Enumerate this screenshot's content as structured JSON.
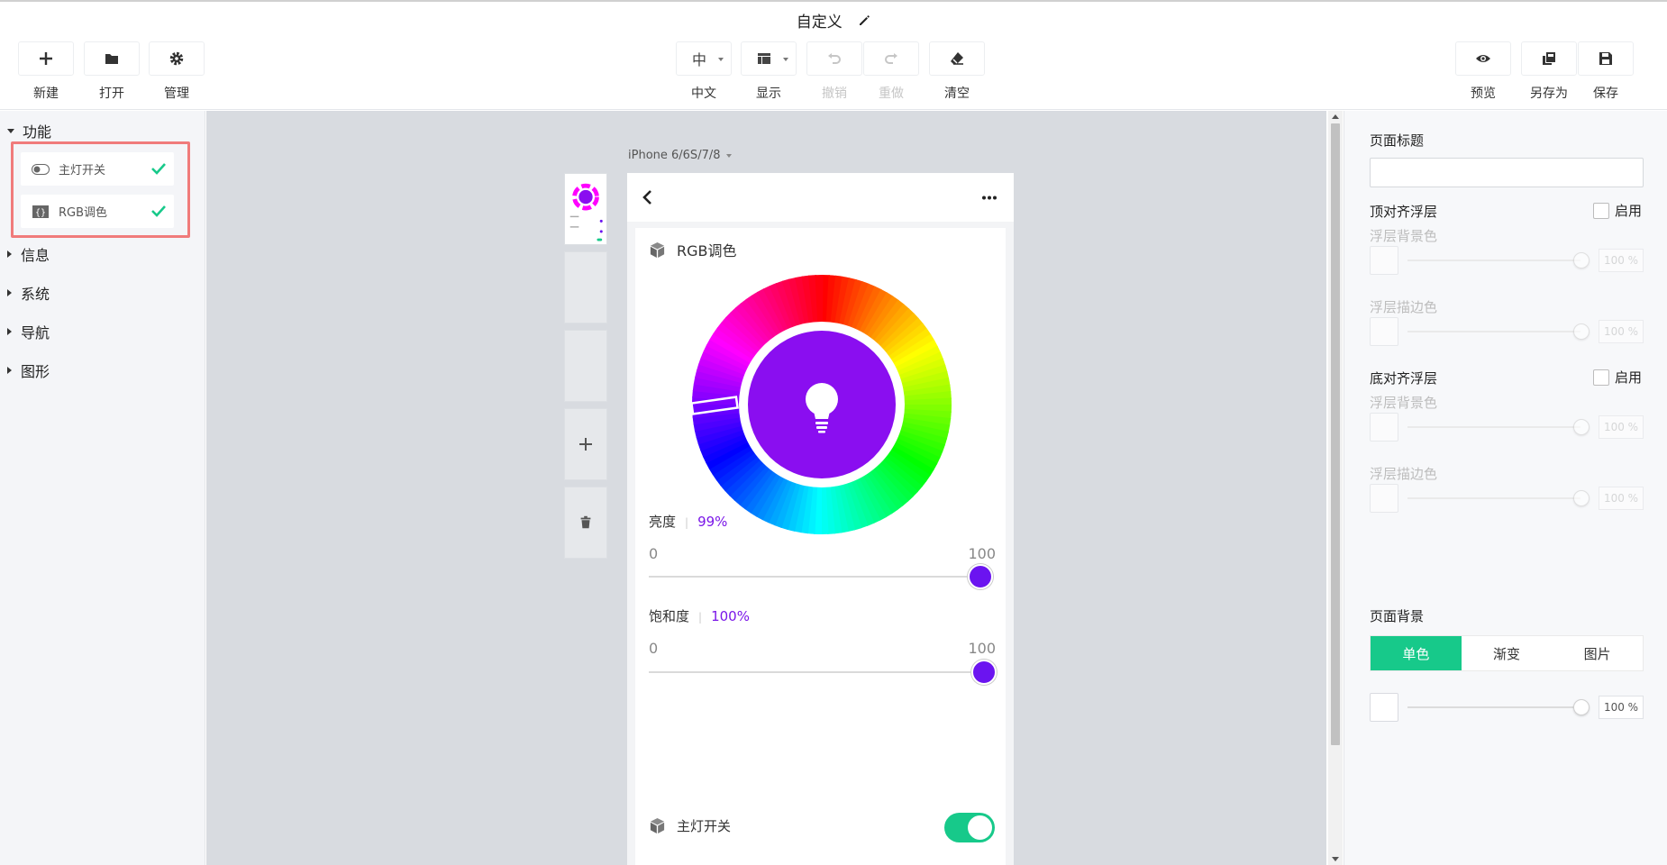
{
  "document": {
    "title": "自定义"
  },
  "toolbar": {
    "new_label": "新建",
    "open_label": "打开",
    "manage_label": "管理",
    "lang_value": "中",
    "lang_label": "中文",
    "display_label": "显示",
    "undo_label": "撤销",
    "redo_label": "重做",
    "clear_label": "清空",
    "preview_label": "预览",
    "save_as_label": "另存为",
    "save_label": "保存"
  },
  "sidebar": {
    "categories": [
      {
        "label": "功能",
        "expanded": true
      },
      {
        "label": "信息",
        "expanded": false
      },
      {
        "label": "系统",
        "expanded": false
      },
      {
        "label": "导航",
        "expanded": false
      },
      {
        "label": "图形",
        "expanded": false
      }
    ],
    "components": [
      {
        "label": "主灯开关",
        "icon": "toggle-icon",
        "added": true
      },
      {
        "label": "RGB调色",
        "icon": "braces-icon",
        "added": true
      }
    ]
  },
  "canvas": {
    "device": "iPhone 6/6S/7/8"
  },
  "phone": {
    "rgb_title": "RGB调色",
    "brightness_label": "亮度",
    "brightness_value": "99%",
    "brightness_min": "0",
    "brightness_max": "100",
    "brightness_fraction": 0.99,
    "saturation_label": "饱和度",
    "saturation_value": "100%",
    "saturation_min": "0",
    "saturation_max": "100",
    "saturation_fraction": 1.0,
    "switch_label": "主灯开关",
    "switch_on": true,
    "selected_color": "#8a0ef0"
  },
  "props": {
    "page_title_label": "页面标题",
    "page_title_value": "",
    "top_layer_label": "顶对齐浮层",
    "top_enable_label": "启用",
    "top_bg_label": "浮层背景色",
    "top_bg_pct": "100 %",
    "top_border_label": "浮层描边色",
    "top_border_pct": "100 %",
    "bottom_layer_label": "底对齐浮层",
    "bottom_enable_label": "启用",
    "bottom_bg_label": "浮层背景色",
    "bottom_bg_pct": "100 %",
    "bottom_border_label": "浮层描边色",
    "bottom_border_pct": "100 %",
    "page_bg_label": "页面背景",
    "bg_tabs": [
      "单色",
      "渐变",
      "图片"
    ],
    "bg_active_tab": 0,
    "bg_pct": "100 %"
  },
  "colors": {
    "accent": "#17c98a",
    "slider": "#6b14f0",
    "highlight": "#f07b7b"
  }
}
